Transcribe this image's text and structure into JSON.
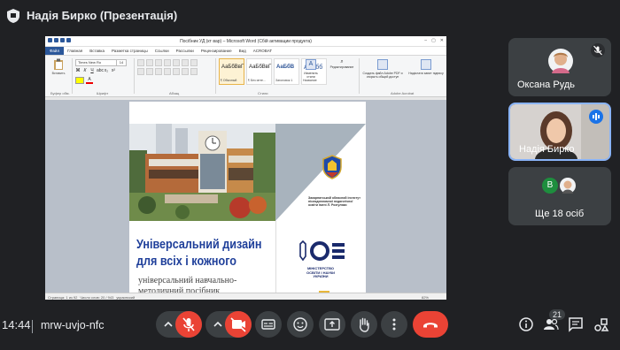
{
  "meeting": {
    "presenter_title": "Надія Бирко (Презентація)",
    "time": "14:44",
    "code": "mrw-uvjo-nfc",
    "participants_count": "21"
  },
  "participants": [
    {
      "name": "Оксана Рудь",
      "muted": true
    },
    {
      "name": "Надія Бирко",
      "speaking": true
    },
    {
      "name": "Ще 18 осіб",
      "avatar_letter": "В",
      "avatar_color": "#1e8e3e"
    }
  ],
  "word": {
    "title": "Посібник УД (кт вар) – Microsoft Word (Сбій активации продукта)",
    "tabs": [
      "Файл",
      "Главная",
      "Вставка",
      "Разметка страницы",
      "Ссылки",
      "Рассылки",
      "Рецензирование",
      "Вид",
      "ACROBAT"
    ],
    "font_name": "Times New Ro",
    "font_size": "14",
    "paste_label": "Вставить",
    "clipboard_label": "Буфер обм.",
    "font_group_label": "Шрифт",
    "paragraph_group_label": "Абзац",
    "styles": [
      {
        "preview": "АаБбВвГ",
        "label": "¶ Обычный",
        "kind": "normal"
      },
      {
        "preview": "АаБбВвГ",
        "label": "¶ Без инте...",
        "kind": "normal"
      },
      {
        "preview": "АаБбВ",
        "label": "Заголовок 1",
        "kind": "heading"
      },
      {
        "preview": "АаБбб",
        "label": "Название",
        "kind": "title"
      }
    ],
    "styles_group_label": "Стили",
    "change_styles": "Изменить стили",
    "edit_label": "Редактирование",
    "pdf_create": "Создать файл Adobe PDF и открыть общий доступ",
    "pdf_sign": "Надіслати запит підпису",
    "acrobat_label": "Adobe Acrobat",
    "status_page": "Страница: 1 из 92",
    "status_words": "Число слов: 20 / 943",
    "status_lang": "украинский",
    "zoom": "82%"
  },
  "document": {
    "cover_title_line1": "Універсальний дизайн",
    "cover_title_line2": "для всіх і кожного",
    "cover_subtitle_line1": "універсальний навчально-",
    "cover_subtitle_line2": "методичний посібник",
    "institute_text": "Закарпатський обласний інститут післядипломної педагогічної освіти імені Л. Розгуляки",
    "ministry_text": "МІНІСТЕРСТВО ОСВІТИ І НАУКИ УКРАЇНИ"
  },
  "colors": {
    "meet_bg": "#202124",
    "tile_bg": "#3c4043",
    "hangup_red": "#ea4335",
    "speaking_blue": "#1a73e8",
    "cover_blue": "#1f3f9a",
    "word_blue": "#2b579a"
  },
  "icons": {
    "presentation": "shield-icon",
    "mic": "mic-off-icon",
    "camera": "camera-off-icon",
    "captions": "captions-icon",
    "emoji": "emoji-icon",
    "present": "present-icon",
    "hand": "raise-hand-icon",
    "more": "more-options-icon",
    "hangup": "hangup-icon",
    "info": "info-icon",
    "people": "people-icon",
    "chat": "chat-icon",
    "activities": "activities-icon"
  }
}
